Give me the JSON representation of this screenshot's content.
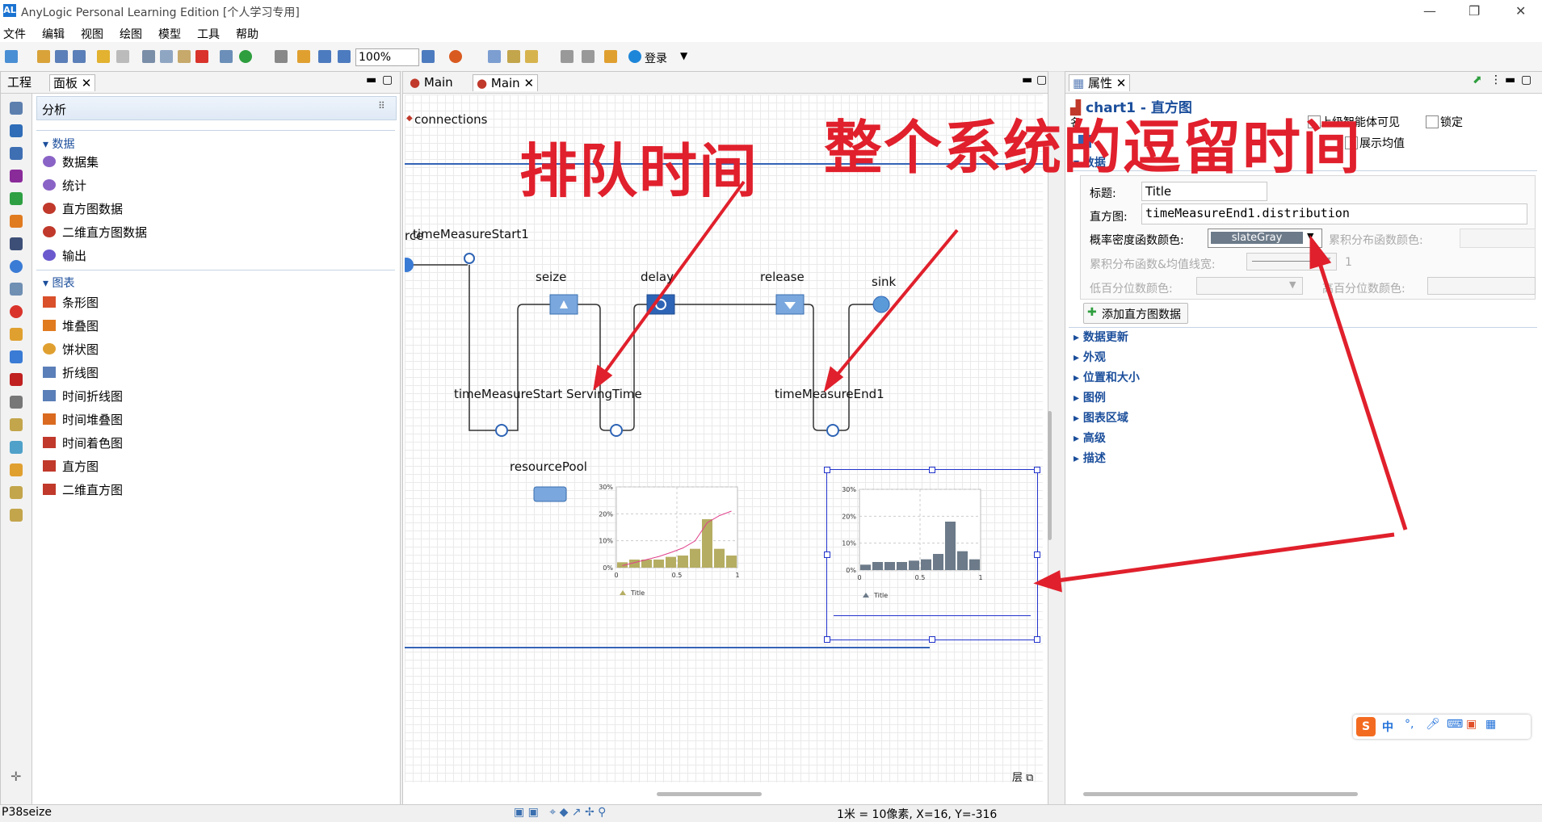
{
  "window": {
    "title": "AnyLogic Personal Learning Edition [个人学习专用]",
    "app_icon": "AL"
  },
  "menu": [
    "文件",
    "编辑",
    "视图",
    "绘图",
    "模型",
    "工具",
    "帮助"
  ],
  "toolbar": {
    "zoom": "100%",
    "login": "登录"
  },
  "left": {
    "tabs": [
      "工程",
      "面板"
    ],
    "palette_title": "分析",
    "sections": [
      {
        "name": "数据",
        "items": [
          "数据集",
          "统计",
          "直方图数据",
          "二维直方图数据",
          "输出"
        ]
      },
      {
        "name": "图表",
        "items": [
          "条形图",
          "堆叠图",
          "饼状图",
          "折线图",
          "时间折线图",
          "时间堆叠图",
          "时间着色图",
          "直方图",
          "二维直方图"
        ]
      }
    ]
  },
  "center": {
    "tabs": [
      "Main",
      "Main"
    ],
    "labels": {
      "connections": "connections",
      "source_partial": "rce",
      "tms1": "timeMeasureStart1",
      "seize": "seize",
      "delay": "delay",
      "release": "release",
      "sink": "sink",
      "tms_serving": "timeMeasureStart ServingTime",
      "tme1": "timeMeasureEnd1",
      "pool": "resourcePool",
      "layers": "层"
    },
    "annotations": {
      "left": "排队时间",
      "right": "整个系统的逗留时间"
    }
  },
  "chart_data": [
    {
      "type": "bar",
      "title": "",
      "legend": "Title",
      "ylabel": "",
      "xlabel": "",
      "ylim": [
        0,
        0.3
      ],
      "xlim": [
        0,
        1
      ],
      "yticks": [
        "0%",
        "10%",
        "20%",
        "30%"
      ],
      "xticks": [
        "0",
        "0.5",
        "1"
      ],
      "values": [
        0.02,
        0.03,
        0.03,
        0.03,
        0.04,
        0.045,
        0.07,
        0.18,
        0.07,
        0.045
      ],
      "cdf": [
        0.02,
        0.05,
        0.08,
        0.11,
        0.15,
        0.195,
        0.265,
        0.445,
        0.515,
        0.56
      ],
      "color": "#b5ad62",
      "cdf_color": "#e0408a"
    },
    {
      "type": "bar",
      "title": "",
      "legend": "Title",
      "ylabel": "",
      "xlabel": "",
      "ylim": [
        0,
        0.3
      ],
      "xlim": [
        0,
        1
      ],
      "yticks": [
        "0%",
        "10%",
        "20%",
        "30%"
      ],
      "xticks": [
        "0",
        "0.5",
        "1"
      ],
      "values": [
        0.02,
        0.03,
        0.03,
        0.03,
        0.035,
        0.04,
        0.06,
        0.18,
        0.07,
        0.04
      ],
      "color": "#6c7a89"
    }
  ],
  "right": {
    "tab": "属性",
    "heading": "chart1 - 直方图",
    "row1": {
      "visible_label": "上级智能体可见",
      "lock_label": "锁定"
    },
    "row2": {
      "show_mean": "展示均值"
    },
    "group_data": "数据",
    "title_label": "标题:",
    "title_value": "Title",
    "hist_label": "直方图:",
    "hist_value": "timeMeasureEnd1.distribution",
    "pdf_color_label": "概率密度函数颜色:",
    "pdf_color_value": "slateGray",
    "cdf_color_label": "累积分布函数颜色:",
    "cdf_width_label": "累积分布函数&均值线宽:",
    "cdf_width_value": "1",
    "low_pct_label": "低百分位数颜色:",
    "high_pct_label": "高百分位数颜色:",
    "add_button": "添加直方图数据",
    "groups": [
      "数据更新",
      "外观",
      "位置和大小",
      "图例",
      "图表区域",
      "高级",
      "描述"
    ]
  },
  "status": {
    "left": "P38seize",
    "scale": "1米 = 10像素, X=16, Y=-316"
  },
  "ime": {
    "label": "中"
  }
}
